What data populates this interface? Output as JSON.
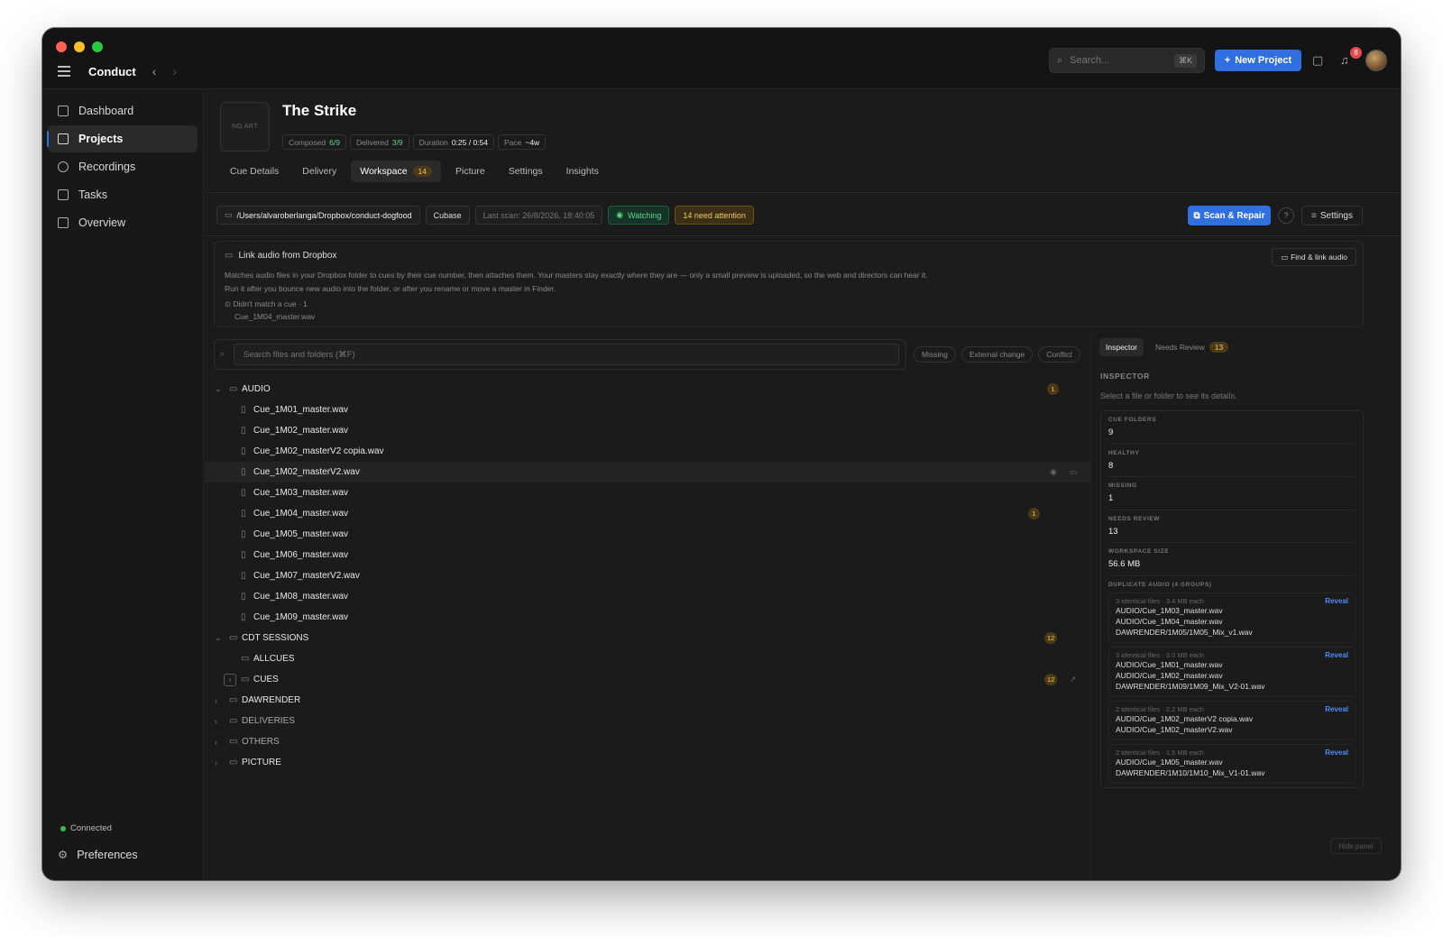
{
  "app": {
    "name": "Conduct"
  },
  "header": {
    "search_placeholder": "Search...",
    "search_shortcut": "⌘K",
    "new_project_label": "New Project",
    "notification_count": "8"
  },
  "sidebar": {
    "items": [
      {
        "label": "Dashboard",
        "icon": "grid-icon",
        "active": false
      },
      {
        "label": "Projects",
        "icon": "folder-icon",
        "active": true
      },
      {
        "label": "Recordings",
        "icon": "record-icon",
        "active": false
      },
      {
        "label": "Tasks",
        "icon": "checkbox-icon",
        "active": false
      },
      {
        "label": "Overview",
        "icon": "list-icon",
        "active": false
      }
    ],
    "status": "Connected",
    "preferences": "Preferences"
  },
  "project": {
    "art_placeholder": "NO ART",
    "title": "The Strike",
    "meta": {
      "composed_label": "Composed",
      "composed_value": "6/9",
      "delivered_label": "Delivered",
      "delivered_value": "3/9",
      "duration_label": "Duration",
      "duration_value": "0:25 / 0:54",
      "pace_label": "Pace",
      "pace_value": "~4w"
    },
    "tabs": [
      {
        "label": "Cue Details"
      },
      {
        "label": "Delivery"
      },
      {
        "label": "Workspace",
        "badge": "14",
        "active": true
      },
      {
        "label": "Picture"
      },
      {
        "label": "Settings"
      },
      {
        "label": "Insights"
      }
    ]
  },
  "workspace": {
    "path": "/Users/alvaroberlanga/Dropbox/conduct-dogfood",
    "daw": "Cubase",
    "last_scan": "Last scan: 26/8/2026, 18:40:05",
    "watching": "Watching",
    "attention": "14 need attention",
    "scan_repair": "Scan & Repair",
    "settings": "Settings",
    "link_panel": {
      "title": "Link audio from Dropbox",
      "desc_line1": "Matches audio files in your Dropbox folder to cues by their cue number, then attaches them. Your masters stay exactly where they are — only a small preview is uploaded, so the web and directors can hear it.",
      "desc_line2": "Run it after you bounce new audio into the folder, or after you rename or move a master in Finder.",
      "unmatched": "Didn't match a cue · 1",
      "unmatched_file": "Cue_1M04_master.wav",
      "find_button": "Find & link audio"
    },
    "search_placeholder": "Search files and folders (⌘F)",
    "filters": [
      "Missing",
      "External change",
      "Conflict"
    ],
    "tree": {
      "audio": {
        "label": "AUDIO",
        "count": "1"
      },
      "audio_files": [
        {
          "name": "Cue_1M01_master.wav"
        },
        {
          "name": "Cue_1M02_master.wav"
        },
        {
          "name": "Cue_1M02_masterV2 copia.wav"
        },
        {
          "name": "Cue_1M02_masterV2.wav",
          "hover": true
        },
        {
          "name": "Cue_1M03_master.wav"
        },
        {
          "name": "Cue_1M04_master.wav",
          "count": "1"
        },
        {
          "name": "Cue_1M05_master.wav"
        },
        {
          "name": "Cue_1M06_master.wav"
        },
        {
          "name": "Cue_1M07_masterV2.wav"
        },
        {
          "name": "Cue_1M08_master.wav"
        },
        {
          "name": "Cue_1M09_master.wav"
        }
      ],
      "cdt": {
        "label": "CDT SESSIONS",
        "count": "12"
      },
      "allcues": {
        "label": "ALLCUES"
      },
      "cues": {
        "label": "CUES",
        "count": "12"
      },
      "dawrender": {
        "label": "DAWRENDER"
      },
      "deliveries": {
        "label": "DELIVERIES"
      },
      "others": {
        "label": "OTHERS"
      },
      "picture": {
        "label": "PICTURE"
      }
    }
  },
  "inspector": {
    "tab_inspector": "Inspector",
    "tab_review": "Needs Review",
    "tab_review_count": "13",
    "heading": "INSPECTOR",
    "hint": "Select a file or folder to see its details.",
    "stats": [
      {
        "key": "CUE FOLDERS",
        "value": "9"
      },
      {
        "key": "HEALTHY",
        "value": "8"
      },
      {
        "key": "MISSING",
        "value": "1"
      },
      {
        "key": "NEEDS REVIEW",
        "value": "13"
      },
      {
        "key": "WORKSPACE SIZE",
        "value": "56.6 MB"
      }
    ],
    "dup_heading": "DUPLICATE AUDIO (4 GROUPS)",
    "reveal": "Reveal",
    "dup_groups": [
      {
        "summary": "3 identical files · 3.4 MB each",
        "files": [
          "AUDIO/Cue_1M03_master.wav",
          "AUDIO/Cue_1M04_master.wav",
          "DAWRENDER/1M05/1M05_Mix_v1.wav"
        ]
      },
      {
        "summary": "3 identical files · 3.0 MB each",
        "files": [
          "AUDIO/Cue_1M01_master.wav",
          "AUDIO/Cue_1M02_master.wav",
          "DAWRENDER/1M09/1M09_Mix_V2-01.wav"
        ]
      },
      {
        "summary": "2 identical files · 2.2 MB each",
        "files": [
          "AUDIO/Cue_1M02_masterV2 copia.wav",
          "AUDIO/Cue_1M02_masterV2.wav"
        ]
      },
      {
        "summary": "2 identical files · 1.5 MB each",
        "files": [
          "AUDIO/Cue_1M05_master.wav",
          "DAWRENDER/1M10/1M10_Mix_V1-01.wav"
        ]
      }
    ],
    "hide_panel": "Hide panel"
  }
}
